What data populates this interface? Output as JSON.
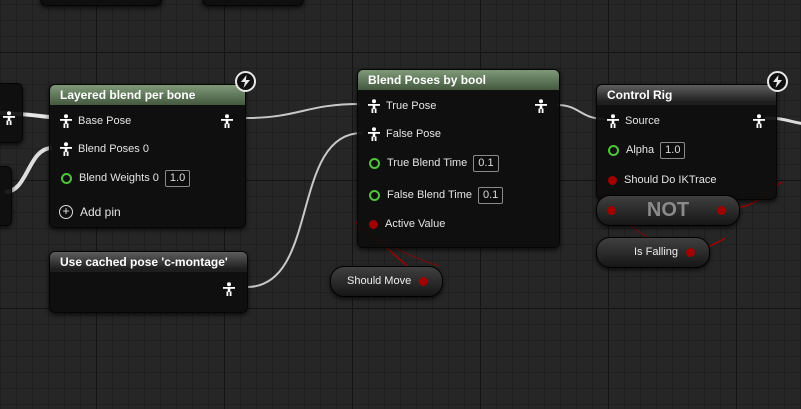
{
  "nodes": {
    "layered_blend": {
      "title": "Layered blend per bone",
      "base_pose": "Base Pose",
      "blend_poses": "Blend Poses 0",
      "blend_weights": "Blend Weights 0",
      "blend_weights_value": "1.0",
      "add_pin": "Add pin"
    },
    "cached_pose": {
      "title": "Use cached pose 'c-montage'"
    },
    "blend_bool": {
      "title": "Blend Poses by bool",
      "true_pose": "True Pose",
      "false_pose": "False Pose",
      "true_blend_time": "True Blend Time",
      "true_blend_time_value": "0.1",
      "false_blend_time": "False Blend Time",
      "false_blend_time_value": "0.1",
      "active_value": "Active Value"
    },
    "control_rig": {
      "title": "Control Rig",
      "source": "Source",
      "alpha": "Alpha",
      "alpha_value": "1.0",
      "should_do_iktrace": "Should Do IKTrace"
    },
    "not_node": {
      "label": "NOT"
    },
    "is_falling": {
      "label": "Is Falling"
    },
    "should_move": {
      "label": "Should Move"
    }
  },
  "colors": {
    "grid": "#262626",
    "pose_wire": "#c8c8c8",
    "bool_pin": "#a10000",
    "float_pin": "#4fc33a",
    "header_green": "#5f7a58",
    "header_gray": "#3a3a3a"
  },
  "icons": {
    "pose_pin": "person-figure-icon",
    "fast_path": "lightning-icon",
    "add": "plus-circle-icon"
  }
}
